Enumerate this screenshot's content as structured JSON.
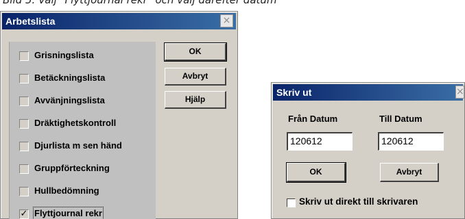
{
  "caption": "Bild 5. Välj \"Flyttjournal rekr\" och välj därefter datum",
  "arbetslista": {
    "title": "Arbetslista",
    "close_glyph": "×",
    "items": [
      {
        "label": "Grisningslista",
        "checked": false
      },
      {
        "label": "Betäckningslista",
        "checked": false
      },
      {
        "label": "Avvänjningslista",
        "checked": false
      },
      {
        "label": "Dräktighetskontroll",
        "checked": false
      },
      {
        "label": "Djurlista m sen händ",
        "checked": false
      },
      {
        "label": "Gruppförteckning",
        "checked": false
      },
      {
        "label": "Hullbedömning",
        "checked": false
      },
      {
        "label": "Flyttjournal rekr",
        "checked": true
      }
    ],
    "checkmark": "✓",
    "buttons": {
      "ok": "OK",
      "cancel": "Avbryt",
      "help": "Hjälp"
    }
  },
  "skrivut": {
    "title": "Skriv ut",
    "close_glyph": "×",
    "from_label": "Från Datum",
    "to_label": "Till Datum",
    "from_value": "120612",
    "to_value": "120612",
    "buttons": {
      "ok": "OK",
      "cancel": "Avbryt"
    },
    "direct_print_label": "Skriv ut direkt till skrivaren"
  }
}
